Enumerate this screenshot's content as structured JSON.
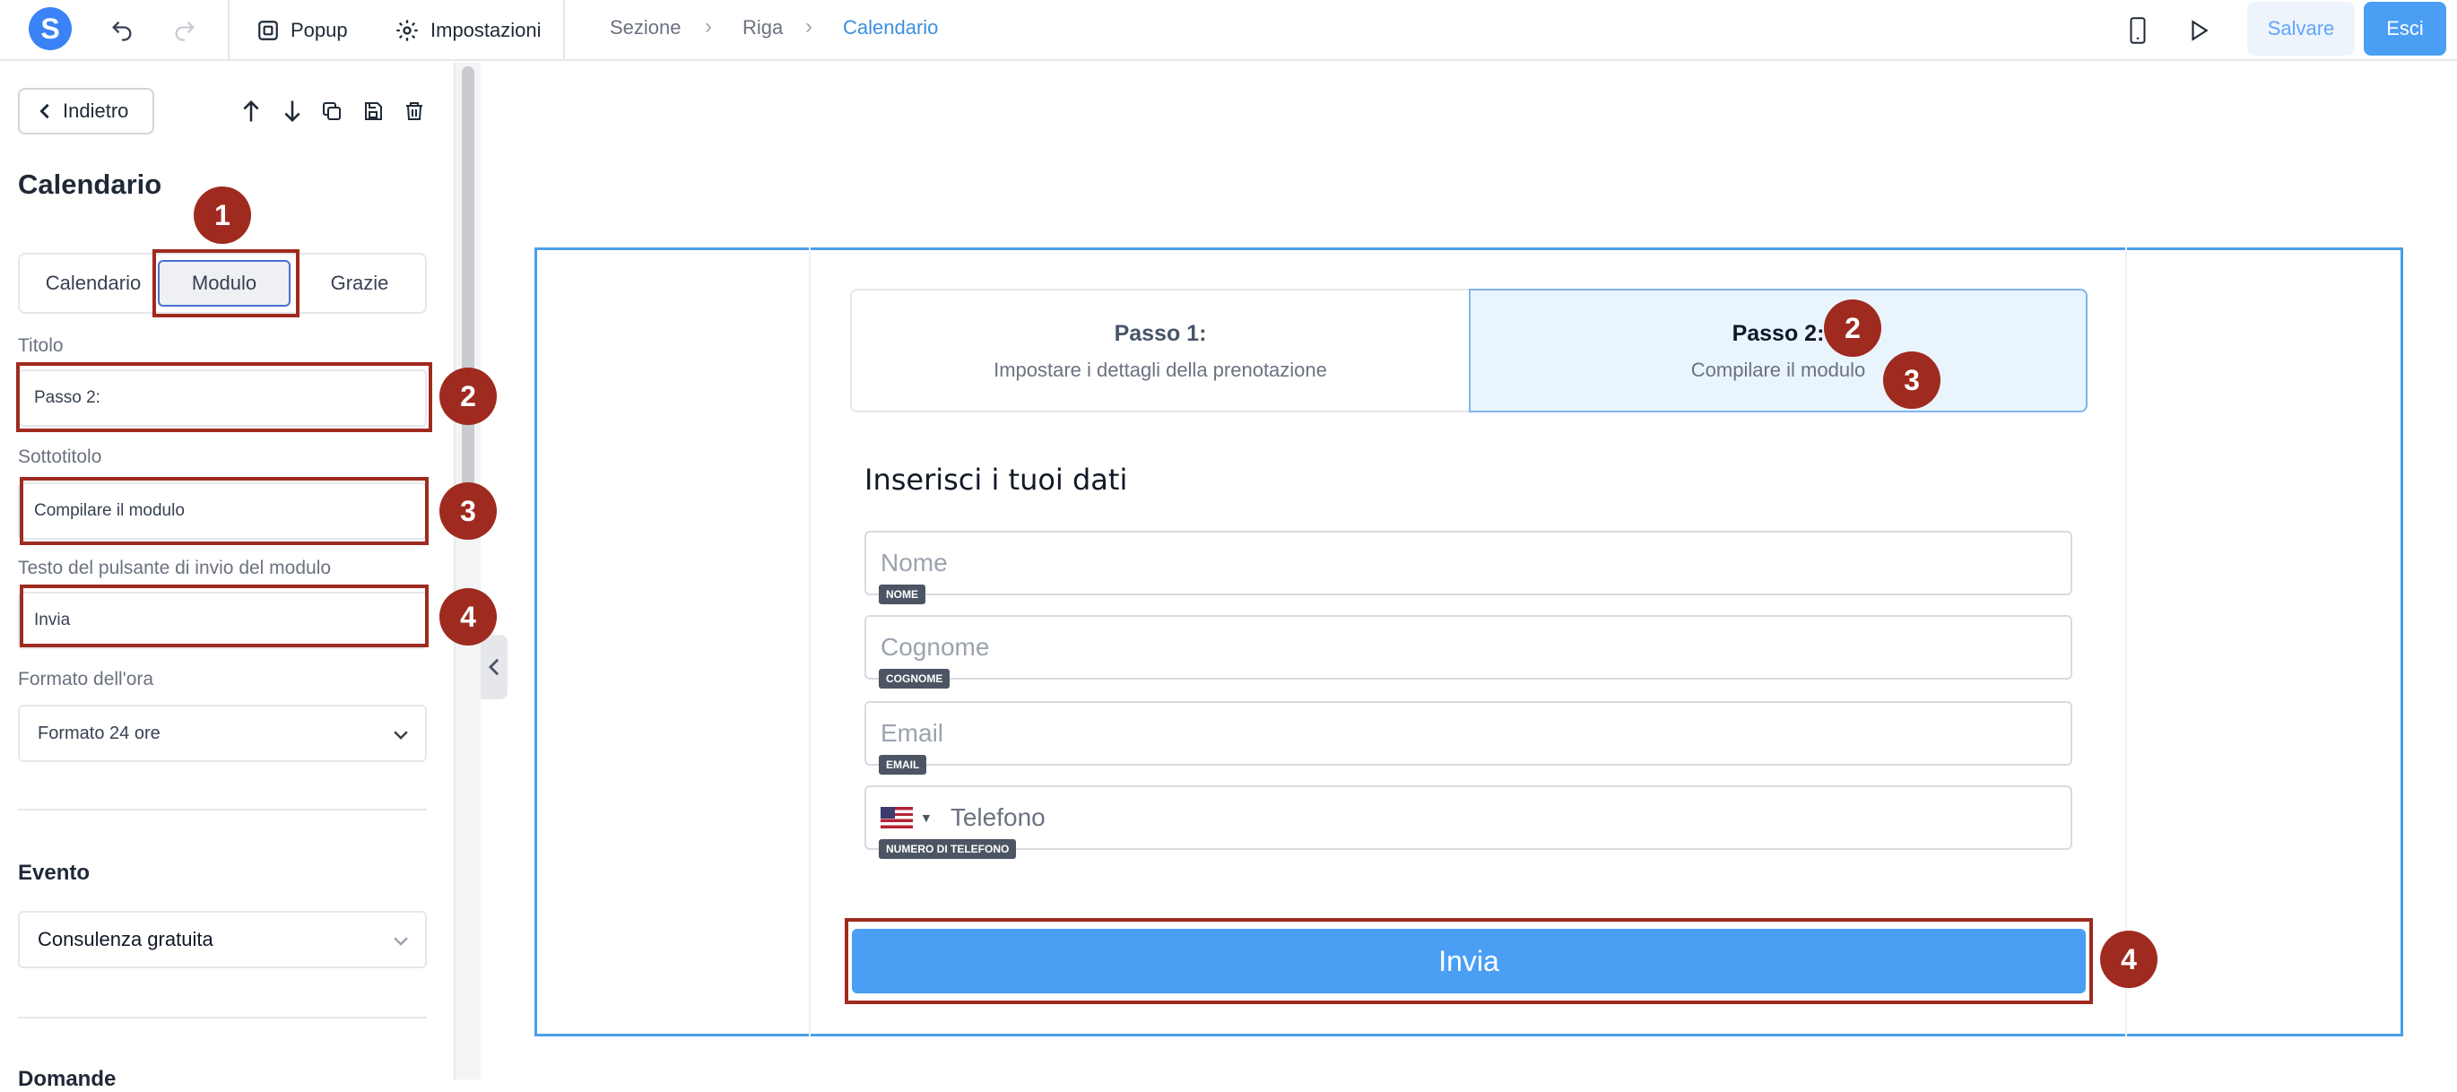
{
  "topbar": {
    "logo_letter": "S",
    "popup_label": "Popup",
    "settings_label": "Impostazioni",
    "breadcrumb": [
      "Sezione",
      "Riga",
      "Calendario"
    ],
    "save_label": "Salvare",
    "exit_label": "Esci"
  },
  "sidebar": {
    "back_label": "Indietro",
    "title": "Calendario",
    "tabs": [
      "Calendario",
      "Modulo",
      "Grazie"
    ],
    "active_tab": "Modulo",
    "fields": {
      "title_label": "Titolo",
      "title_value": "Passo 2:",
      "subtitle_label": "Sottotitolo",
      "subtitle_value": "Compilare il modulo",
      "submit_text_label": "Testo del pulsante di invio del modulo",
      "submit_text_value": "Invia",
      "time_format_label": "Formato dell'ora",
      "time_format_value": "Formato 24 ore"
    },
    "event_section": "Evento",
    "event_value": "Consulenza gratuita",
    "next_section": "Domande"
  },
  "annotations": [
    "1",
    "2",
    "3",
    "4",
    "2",
    "3",
    "4"
  ],
  "preview": {
    "steps": [
      {
        "title": "Passo 1:",
        "subtitle": "Impostare i dettagli della prenotazione"
      },
      {
        "title": "Passo 2:",
        "subtitle": "Compilare il modulo"
      }
    ],
    "heading": "Inserisci i tuoi dati",
    "inputs": [
      {
        "placeholder": "Nome",
        "tag": "NOME"
      },
      {
        "placeholder": "Cognome",
        "tag": "COGNOME"
      },
      {
        "placeholder": "Email",
        "tag": "EMAIL"
      },
      {
        "placeholder": "Telefono",
        "tag": "NUMERO DI TELEFONO"
      }
    ],
    "submit_label": "Invia"
  },
  "colors": {
    "accent": "#4a9ff5",
    "highlight": "#9f2a1f",
    "frame": "#4a9fe8"
  }
}
